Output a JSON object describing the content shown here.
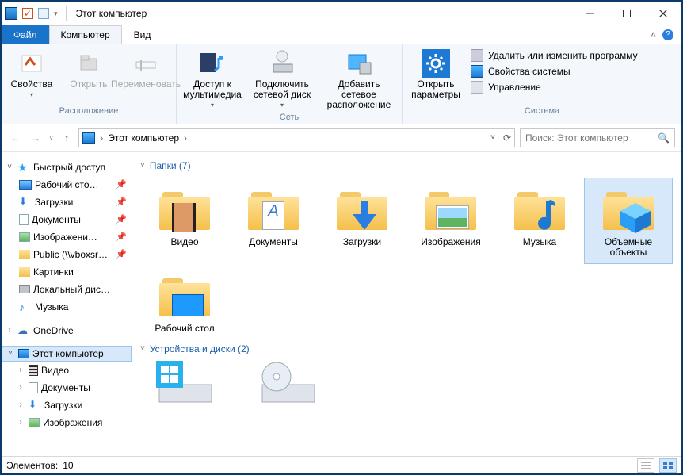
{
  "window": {
    "title": "Этот компьютер"
  },
  "tabs": {
    "file": "Файл",
    "computer": "Компьютер",
    "view": "Вид"
  },
  "ribbon": {
    "g1_caption": "Расположение",
    "b_props": "Свойства",
    "b_open": "Открыть",
    "b_rename": "Переименовать",
    "g2_caption": "Сеть",
    "b_media": "Доступ к мультимедиа",
    "b_netdrive": "Подключить сетевой диск",
    "b_netloc": "Добавить сетевое расположение",
    "g3_caption": "Система",
    "b_settings": "Открыть параметры",
    "s1": "Удалить или изменить программу",
    "s2": "Свойства системы",
    "s3": "Управление"
  },
  "breadcrumb": {
    "current": "Этот компьютер"
  },
  "search": {
    "placeholder": "Поиск: Этот компьютер"
  },
  "tree": {
    "quick": "Быстрый доступ",
    "q_desktop": "Рабочий сто…",
    "q_downloads": "Загрузки",
    "q_docs": "Документы",
    "q_images": "Изображени…",
    "q_public": "Public (\\\\vboxsr…",
    "q_pics": "Картинки",
    "q_local": "Локальный дис…",
    "q_music": "Музыка",
    "onedrive": "OneDrive",
    "thispc": "Этот компьютер",
    "pc_video": "Видео",
    "pc_docs": "Документы",
    "pc_down": "Загрузки",
    "pc_img": "Изображения"
  },
  "content": {
    "group_folders": "Папки (7)",
    "group_drives": "Устройства и диски (2)",
    "items": {
      "video": "Видео",
      "docs": "Документы",
      "down": "Загрузки",
      "img": "Изображения",
      "music": "Музыка",
      "obj3d": "Объемные объекты",
      "desktop": "Рабочий стол"
    }
  },
  "status": {
    "count_label": "Элементов:",
    "count": "10"
  }
}
